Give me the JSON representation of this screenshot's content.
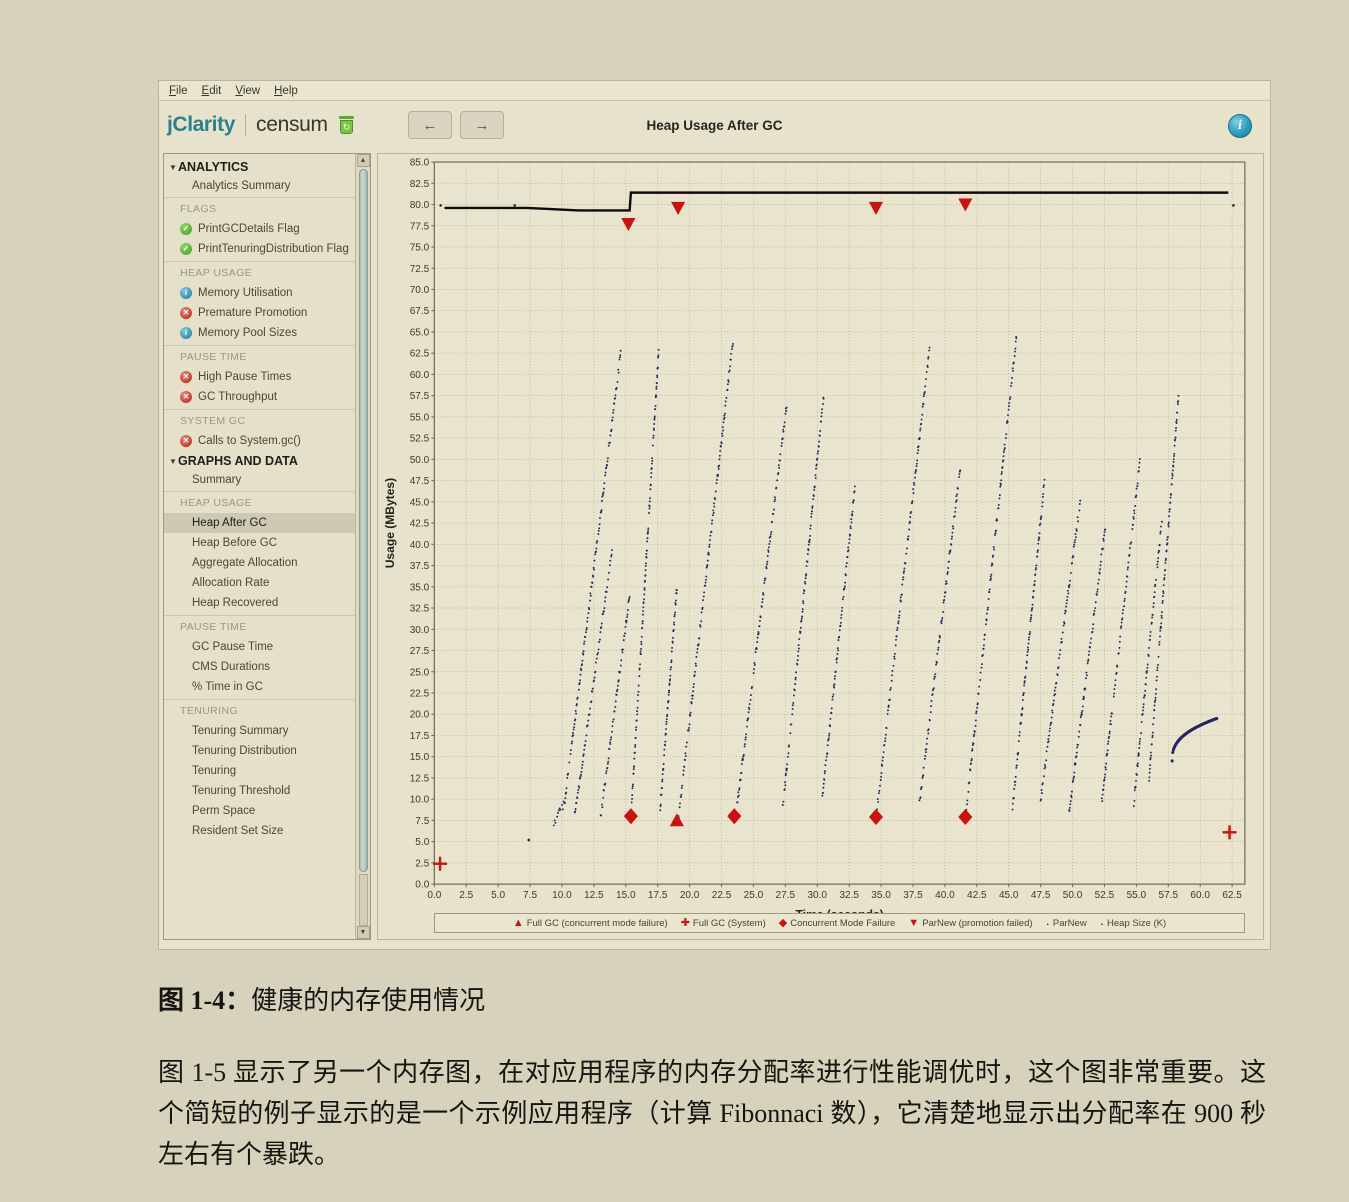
{
  "window": {
    "menubar": [
      {
        "mnemonic": "F",
        "rest": "ile"
      },
      {
        "mnemonic": "E",
        "rest": "dit"
      },
      {
        "mnemonic": "V",
        "rest": "iew"
      },
      {
        "mnemonic": "H",
        "rest": "elp"
      }
    ],
    "brand": {
      "primary": "jClarity",
      "secondary": "censum",
      "logo": "recycle-bin-icon"
    },
    "nav": {
      "back": "←",
      "forward": "→"
    },
    "view_title": "Heap Usage After GC",
    "info": "i"
  },
  "sidebar": {
    "groups": [
      {
        "title": "ANALYTICS",
        "sub": "Analytics Summary",
        "sections": [
          {
            "label": "FLAGS",
            "items": [
              {
                "label": "PrintGCDetails Flag",
                "status": "ok"
              },
              {
                "label": "PrintTenuringDistribution Flag",
                "status": "ok"
              }
            ]
          },
          {
            "label": "HEAP USAGE",
            "items": [
              {
                "label": "Memory Utilisation",
                "status": "info"
              },
              {
                "label": "Premature Promotion",
                "status": "err"
              },
              {
                "label": "Memory Pool Sizes",
                "status": "info"
              }
            ]
          },
          {
            "label": "PAUSE TIME",
            "items": [
              {
                "label": "High Pause Times",
                "status": "err"
              },
              {
                "label": "GC Throughput",
                "status": "err"
              }
            ]
          },
          {
            "label": "SYSTEM GC",
            "items": [
              {
                "label": "Calls to System.gc()",
                "status": "err"
              }
            ]
          }
        ]
      },
      {
        "title": "GRAPHS AND DATA",
        "sub": "Summary",
        "sections": [
          {
            "label": "HEAP USAGE",
            "items": [
              {
                "label": "Heap After GC",
                "selected": true
              },
              {
                "label": "Heap Before GC"
              },
              {
                "label": "Aggregate Allocation"
              },
              {
                "label": "Allocation Rate"
              },
              {
                "label": "Heap Recovered"
              }
            ]
          },
          {
            "label": "PAUSE TIME",
            "items": [
              {
                "label": "GC Pause Time"
              },
              {
                "label": "CMS Durations"
              },
              {
                "label": "% Time in GC"
              }
            ]
          },
          {
            "label": "TENURING",
            "items": [
              {
                "label": "Tenuring Summary"
              },
              {
                "label": "Tenuring Distribution"
              },
              {
                "label": "Tenuring"
              },
              {
                "label": "Tenuring Threshold"
              },
              {
                "label": "Perm Space"
              },
              {
                "label": "Resident Set Size"
              }
            ]
          }
        ]
      }
    ],
    "scroll": {
      "up": "▲",
      "down": "▼"
    }
  },
  "legend": [
    {
      "symbol": "▲",
      "label": "Full GC (concurrent mode failure)",
      "color": "#cc1111"
    },
    {
      "symbol": "✚",
      "label": "Full GC (System)",
      "color": "#cc1111"
    },
    {
      "symbol": "◆",
      "label": "Concurrent Mode Failure",
      "color": "#cc1111"
    },
    {
      "symbol": "▼",
      "label": "ParNew (promotion failed)",
      "color": "#cc1111"
    },
    {
      "symbol": "·",
      "label": "ParNew",
      "color": "#2b2a6b"
    },
    {
      "symbol": "·",
      "label": "Heap Size (K)",
      "color": "#111111"
    }
  ],
  "caption": {
    "figure": "图 1-4：",
    "text": "健康的内存使用情况"
  },
  "body_text": "图 1-5 显示了另一个内存图，在对应用程序的内存分配率进行性能调优时，这个图非常重要。这个简短的例子显示的是一个示例应用程序（计算 Fibonnaci 数），它清楚地显示出分配率在 900 秒左右有个暴跌。",
  "chart_data": {
    "type": "scatter",
    "title": "Heap Usage After GC",
    "xlabel": "Time (seconds)",
    "ylabel": "Usage (MBytes)",
    "xlim": [
      0.0,
      63.5
    ],
    "ylim": [
      0.0,
      85.0
    ],
    "xticks": [
      0.0,
      2.5,
      5.0,
      7.5,
      10.0,
      12.5,
      15.0,
      17.5,
      20.0,
      22.5,
      25.0,
      27.5,
      30.0,
      32.5,
      35.0,
      37.5,
      40.0,
      42.5,
      45.0,
      47.5,
      50.0,
      52.5,
      55.0,
      57.5,
      60.0,
      62.5
    ],
    "yticks": [
      0.0,
      2.5,
      5.0,
      7.5,
      10.0,
      12.5,
      15.0,
      17.5,
      20.0,
      22.5,
      25.0,
      27.5,
      30.0,
      32.5,
      35.0,
      37.5,
      40.0,
      42.5,
      45.0,
      47.5,
      50.0,
      52.5,
      55.0,
      57.5,
      60.0,
      62.5,
      65.0,
      67.5,
      70.0,
      72.5,
      75.0,
      77.5,
      80.0,
      82.5,
      85.0
    ],
    "grid": true,
    "legend_position": "bottom",
    "series": [
      {
        "name": "ParNew",
        "marker": "dot",
        "color": "#2b2a6b",
        "comment": "sawtooth: heap fills then drops at each collection",
        "sawteeth": [
          {
            "x0": 9.3,
            "y0": 7.0,
            "x1": 10.2,
            "y1": 9.6
          },
          {
            "x0": 10.2,
            "y0": 9.5,
            "x1": 14.6,
            "y1": 62.5
          },
          {
            "x0": 11.0,
            "y0": 8.0,
            "x1": 14.0,
            "y1": 40.0
          },
          {
            "x0": 13.0,
            "y0": 7.6,
            "x1": 15.3,
            "y1": 34.0
          },
          {
            "x0": 15.4,
            "y0": 7.8,
            "x1": 17.6,
            "y1": 63.5
          },
          {
            "x0": 17.7,
            "y0": 9.0,
            "x1": 19.0,
            "y1": 35.0
          },
          {
            "x0": 19.1,
            "y0": 7.5,
            "x1": 23.4,
            "y1": 64.0
          },
          {
            "x0": 23.6,
            "y0": 7.8,
            "x1": 27.6,
            "y1": 56.5
          },
          {
            "x0": 27.3,
            "y0": 9.0,
            "x1": 30.5,
            "y1": 57.5
          },
          {
            "x0": 30.4,
            "y0": 10.2,
            "x1": 33.0,
            "y1": 47.5
          },
          {
            "x0": 34.6,
            "y0": 7.8,
            "x1": 38.8,
            "y1": 63.0
          },
          {
            "x0": 38.0,
            "y0": 9.5,
            "x1": 41.2,
            "y1": 49.0
          },
          {
            "x0": 41.6,
            "y0": 7.8,
            "x1": 45.6,
            "y1": 64.5
          },
          {
            "x0": 45.3,
            "y0": 9.0,
            "x1": 47.8,
            "y1": 47.5
          },
          {
            "x0": 47.5,
            "y0": 10.0,
            "x1": 50.6,
            "y1": 45.0
          },
          {
            "x0": 49.7,
            "y0": 8.0,
            "x1": 52.6,
            "y1": 42.5
          },
          {
            "x0": 52.3,
            "y0": 9.8,
            "x1": 55.3,
            "y1": 50.0
          },
          {
            "x0": 54.8,
            "y0": 9.5,
            "x1": 57.0,
            "y1": 43.0
          },
          {
            "x0": 56.0,
            "y0": 12.5,
            "x1": 58.3,
            "y1": 57.5
          }
        ],
        "tail": {
          "x0": 57.8,
          "y0": 14.5,
          "x1": 61.3,
          "y1": 19.5,
          "shape": "rising-plateau"
        }
      },
      {
        "name": "Heap Size (K)",
        "marker": "step-line",
        "color": "#111111",
        "points": [
          {
            "x": 0.8,
            "y": 79.6
          },
          {
            "x": 7.3,
            "y": 79.6
          },
          {
            "x": 11.3,
            "y": 79.3
          },
          {
            "x": 15.3,
            "y": 79.3
          },
          {
            "x": 15.4,
            "y": 81.4
          },
          {
            "x": 62.2,
            "y": 81.4
          }
        ]
      }
    ],
    "events": [
      {
        "type": "Full GC (System)",
        "symbol": "✚",
        "x": 0.45,
        "y": 2.4
      },
      {
        "type": "Full GC (System)",
        "symbol": "✚",
        "x": 62.3,
        "y": 6.1
      },
      {
        "type": "Concurrent Mode Failure",
        "symbol": "◆",
        "x": 15.4,
        "y": 8.0
      },
      {
        "type": "Full GC (concurrent mode failure)",
        "symbol": "▲",
        "x": 19.0,
        "y": 7.4
      },
      {
        "type": "Concurrent Mode Failure",
        "symbol": "◆",
        "x": 23.5,
        "y": 8.0
      },
      {
        "type": "Concurrent Mode Failure",
        "symbol": "◆",
        "x": 34.6,
        "y": 7.9
      },
      {
        "type": "Concurrent Mode Failure",
        "symbol": "◆",
        "x": 41.6,
        "y": 7.9
      },
      {
        "type": "ParNew (promotion failed)",
        "symbol": "▼",
        "x": 15.2,
        "y": 77.7
      },
      {
        "type": "ParNew (promotion failed)",
        "symbol": "▼",
        "x": 19.1,
        "y": 79.6
      },
      {
        "type": "ParNew (promotion failed)",
        "symbol": "▼",
        "x": 34.6,
        "y": 79.6
      },
      {
        "type": "ParNew (promotion failed)",
        "symbol": "▼",
        "x": 41.6,
        "y": 80.0
      }
    ],
    "stray_points": [
      {
        "x": 0.5,
        "y": 79.9
      },
      {
        "x": 6.3,
        "y": 79.9
      },
      {
        "x": 62.6,
        "y": 79.9
      },
      {
        "x": 7.4,
        "y": 5.2
      }
    ]
  }
}
